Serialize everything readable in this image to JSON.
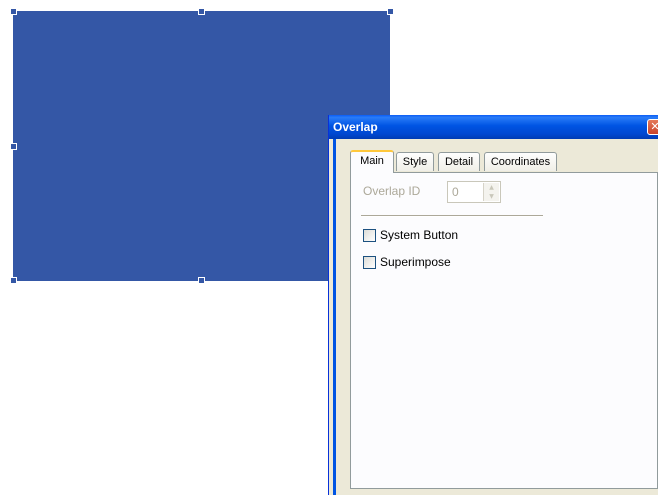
{
  "dialog": {
    "title": "Overlap",
    "close_glyph": "✕",
    "tabs": [
      {
        "label": "Main",
        "active": true
      },
      {
        "label": "Style",
        "active": false
      },
      {
        "label": "Detail",
        "active": false
      },
      {
        "label": "Coordinates",
        "active": false
      }
    ],
    "main": {
      "overlap_id_label": "Overlap ID",
      "overlap_id_value": "0",
      "spin_up_glyph": "▲",
      "spin_down_glyph": "▼",
      "system_button_label": "System Button",
      "system_button_checked": false,
      "superimpose_label": "Superimpose",
      "superimpose_checked": false
    }
  },
  "colors": {
    "shape_fill": "#3457a6",
    "titlebar": "#0054e3",
    "dialog_bg": "#ece9d8",
    "active_tab_accent": "#ffc83c"
  }
}
